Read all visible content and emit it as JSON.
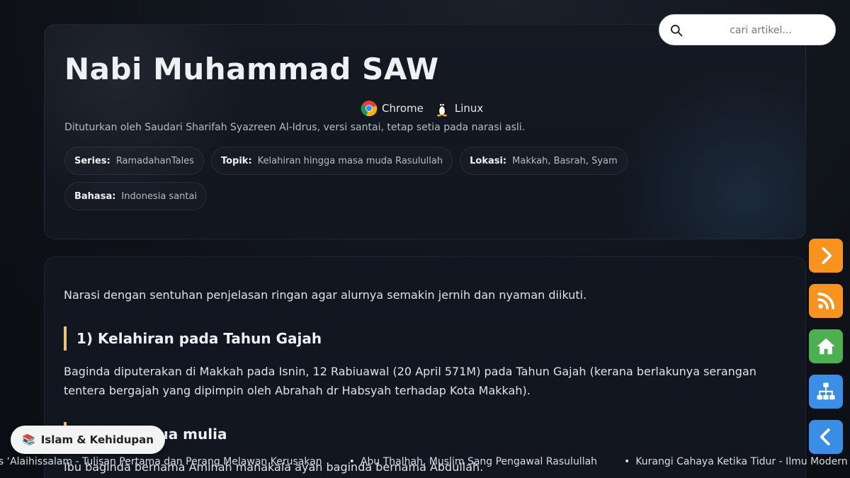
{
  "header": {
    "title": "Nabi Muhammad SAW",
    "badges": [
      {
        "label": "Chrome",
        "icon": "chrome-icon"
      },
      {
        "label": "Linux",
        "icon": "linux-tux-icon"
      }
    ],
    "subtitle": "Dituturkan oleh Saudari Sharifah Syazreen Al-Idrus, versi santai, tetap setia pada narasi asli.",
    "meta": [
      {
        "key": "Series:",
        "value": "RamadahanTales"
      },
      {
        "key": "Topik:",
        "value": "Kelahiran hingga masa muda Rasulullah"
      },
      {
        "key": "Lokasi:",
        "value": "Makkah, Basrah, Syam"
      },
      {
        "key": "Bahasa:",
        "value": "Indonesia santai"
      }
    ]
  },
  "search": {
    "placeholder": "cari artikel...",
    "icon": "search-icon"
  },
  "article": {
    "intro": "Narasi dengan sentuhan penjelasan ringan agar alurnya semakin jernih dan nyaman diikuti.",
    "sections": [
      {
        "heading": "1) Kelahiran pada Tahun Gajah",
        "body": "Baginda diputerakan di Makkah pada Isnin, 12 Rabiuawal (20 April 571M) pada Tahun Gajah (kerana berlakunya serangan tentera bergajah yang dipimpin oleh Abrahah dr Habsyah terhadap Kota Makkah)."
      },
      {
        "heading": "2) Orang tua mulia",
        "body": "Ibu baginda bernama Aminah manakala ayah baginda bernama Abdullah."
      }
    ]
  },
  "side_buttons": [
    {
      "name": "next-button",
      "icon": "chevron-right-icon",
      "color": "#f7931e"
    },
    {
      "name": "rss-button",
      "icon": "rss-icon",
      "color": "#f7931e"
    },
    {
      "name": "home-button",
      "icon": "home-icon",
      "color": "#4caf50"
    },
    {
      "name": "sitemap-button",
      "icon": "sitemap-icon",
      "color": "#3a8ee6"
    },
    {
      "name": "back-button",
      "icon": "chevron-left-icon",
      "color": "#3a8ee6"
    }
  ],
  "category_pill": {
    "emoji": "📚",
    "label": "Islam & Kehidupan"
  },
  "ticker": [
    "is ‘Alaihissalam - Tulisan Pertama dan Perang Melawan Kerusakan",
    "Abu Thalhah, Muslim Sang Pengawal Rasulullah",
    "Kurangi Cahaya Ketika Tidur - Ilmu Modern dan Sunnah"
  ],
  "colors": {
    "accent": "#f0c36a",
    "orange": "#f7931e",
    "green": "#4caf50",
    "blue": "#3a8ee6"
  }
}
